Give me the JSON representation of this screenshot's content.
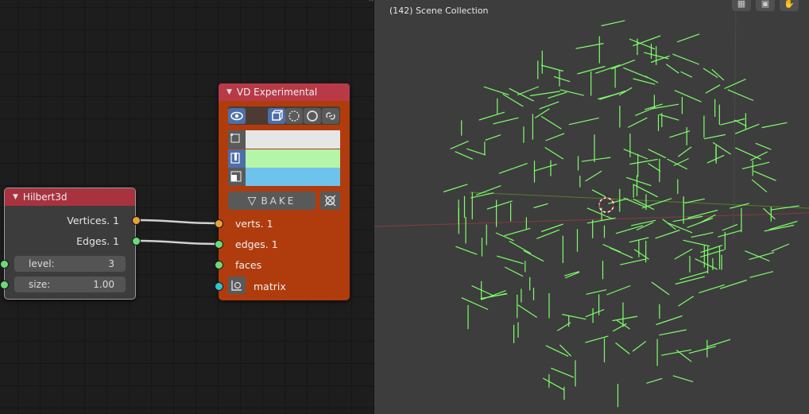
{
  "node_editor": {
    "hilbert_node": {
      "title": "Hilbert3d",
      "outputs": [
        "Vertices. 1",
        "Edges. 1"
      ],
      "params": [
        {
          "label": "level:",
          "value": "3"
        },
        {
          "label": "size:",
          "value": "1.00"
        }
      ]
    },
    "vd_node": {
      "title": "VD Experimental",
      "toolbar_icons": [
        "eye-icon",
        "cube-icon",
        "circle-outline-icon",
        "circle-icon",
        "link-icon"
      ],
      "colors": {
        "vertex": "#e6e6e6",
        "edge": "#b4f5a8",
        "face": "#6ec3ec"
      },
      "bake_label": "BAKE",
      "inputs": [
        "verts. 1",
        "edges. 1",
        "faces",
        "matrix"
      ]
    },
    "colors": {
      "link": "#d0d0d0",
      "header_red": "#a8323e",
      "vd_body": "#b03c0e"
    }
  },
  "viewport": {
    "scene_label": "(142) Scene Collection",
    "nav_icons": [
      "grid-icon",
      "camera-icon",
      "hand-icon"
    ],
    "line_color": "#7dff6a"
  }
}
